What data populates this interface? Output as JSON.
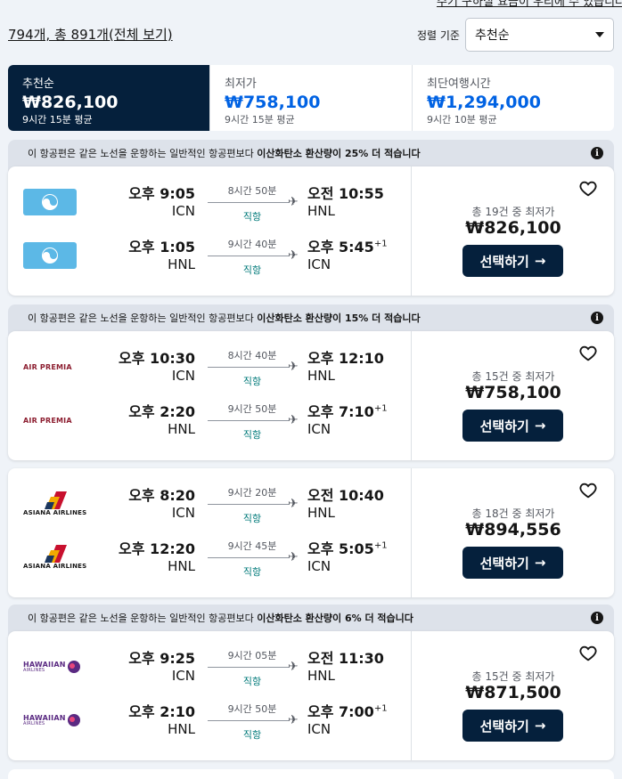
{
  "top_cut_text": "주기 구하실 요금이 우리에 수 있습니다",
  "summary": {
    "text": "794개, 총 891개(전체 보기)"
  },
  "sort": {
    "label": "정렬 기준",
    "value": "추천순"
  },
  "tabs": [
    {
      "name": "추천순",
      "price": "₩826,100",
      "sub": "9시간 15분 평균"
    },
    {
      "name": "최저가",
      "price": "₩758,100",
      "sub": "9시간 15분 평균"
    },
    {
      "name": "최단여행시간",
      "price": "₩1,294,000",
      "sub": "9시간 10분 평균"
    }
  ],
  "results": [
    {
      "eco_pre": "이 항공편은 같은 노선을 운항하는 일반적인 항공편보다 ",
      "eco_bold": "이산화탄소 환산량이 25% 더 적습니다",
      "airline": "korean",
      "legs": [
        {
          "dep_time": "오후 9:05",
          "dep_code": "ICN",
          "duration": "8시간 50분",
          "stops": "직항",
          "arr_time": "오전 10:55",
          "arr_code": "HNL",
          "next_day": ""
        },
        {
          "dep_time": "오후 1:05",
          "dep_code": "HNL",
          "duration": "9시간 40분",
          "stops": "직항",
          "arr_time": "오후 5:45",
          "arr_code": "ICN",
          "next_day": "+1"
        }
      ],
      "deals": "총 19건 중 최저가",
      "price": "₩826,100",
      "button": "선택하기"
    },
    {
      "eco_pre": "이 항공편은 같은 노선을 운항하는 일반적인 항공편보다 ",
      "eco_bold": "이산화탄소 환산량이 15% 더 적습니다",
      "airline": "premia",
      "logo_text": "AIR PREMIA",
      "legs": [
        {
          "dep_time": "오후 10:30",
          "dep_code": "ICN",
          "duration": "8시간 40분",
          "stops": "직항",
          "arr_time": "오후 12:10",
          "arr_code": "HNL",
          "next_day": ""
        },
        {
          "dep_time": "오후 2:20",
          "dep_code": "HNL",
          "duration": "9시간 50분",
          "stops": "직항",
          "arr_time": "오후 7:10",
          "arr_code": "ICN",
          "next_day": "+1"
        }
      ],
      "deals": "총 15건 중 최저가",
      "price": "₩758,100",
      "button": "선택하기"
    },
    {
      "eco_pre": "",
      "eco_bold": "",
      "airline": "asiana",
      "logo_text": "ASIANA AIRLINES",
      "legs": [
        {
          "dep_time": "오후 8:20",
          "dep_code": "ICN",
          "duration": "9시간 20분",
          "stops": "직항",
          "arr_time": "오전 10:40",
          "arr_code": "HNL",
          "next_day": ""
        },
        {
          "dep_time": "오후 12:20",
          "dep_code": "HNL",
          "duration": "9시간 45분",
          "stops": "직항",
          "arr_time": "오후 5:05",
          "arr_code": "ICN",
          "next_day": "+1"
        }
      ],
      "deals": "총 18건 중 최저가",
      "price": "₩894,556",
      "button": "선택하기"
    },
    {
      "eco_pre": "이 항공편은 같은 노선을 운항하는 일반적인 항공편보다 ",
      "eco_bold": "이산화탄소 환산량이 6% 더 적습니다",
      "airline": "hawaiian",
      "logo_text": "HAWAIIAN",
      "logo_sub": "AIRLINES",
      "legs": [
        {
          "dep_time": "오후 9:25",
          "dep_code": "ICN",
          "duration": "9시간 05분",
          "stops": "직항",
          "arr_time": "오전 11:30",
          "arr_code": "HNL",
          "next_day": ""
        },
        {
          "dep_time": "오후 2:10",
          "dep_code": "HNL",
          "duration": "9시간 50분",
          "stops": "직항",
          "arr_time": "오후 7:00",
          "arr_code": "ICN",
          "next_day": "+1"
        }
      ],
      "deals": "총 15건 중 최저가",
      "price": "₩871,500",
      "button": "선택하기"
    }
  ],
  "colors": {
    "navy": "#05203c",
    "accent_blue": "#0062e3",
    "direct_teal": "#007a7a",
    "korean_air_blue": "#5cb8e6"
  }
}
